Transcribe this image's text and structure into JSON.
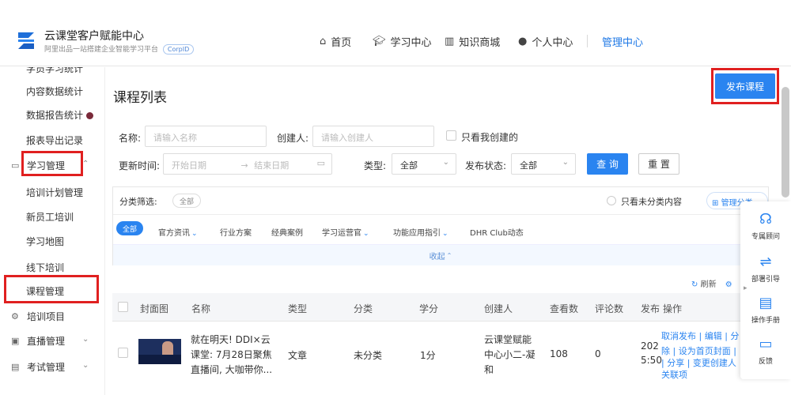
{
  "brand": {
    "title": "云课堂客户赋能中心",
    "subtitle": "阿里出品一站搭建企业智能学习平台",
    "corp_tag": "CorpID"
  },
  "nav": {
    "home": "首页",
    "learning": "学习中心",
    "mall": "知识商城",
    "personal": "个人中心",
    "admin": "管理中心"
  },
  "sidebar": {
    "partial_top": "学员学习统计",
    "items": [
      "内容数据统计",
      "数据报告统计",
      "报表导出记录"
    ],
    "group_learning": "学习管理",
    "sub_items": [
      "培训计划管理",
      "新员工培训",
      "学习地图",
      "线下培训",
      "课程管理"
    ],
    "group_training": "培训项目",
    "group_live": "直播管理",
    "group_exam": "考试管理"
  },
  "page": {
    "title": "课程列表",
    "publish_button": "发布课程"
  },
  "filters": {
    "name_label": "名称:",
    "name_placeholder": "请输入名称",
    "creator_label": "创建人:",
    "creator_placeholder": "请输入创建人",
    "mine_only": "只看我创建的",
    "update_time_label": "更新时间:",
    "start_date": "开始日期",
    "date_sep": "→",
    "end_date": "结束日期",
    "type_label": "类型:",
    "type_value": "全部",
    "status_label": "发布状态:",
    "status_value": "全部",
    "query_button": "查 询",
    "reset_button": "重 置"
  },
  "categories": {
    "filter_label": "分类筛选:",
    "all_tag": "全部",
    "uncategorized": "只看未分类内容",
    "manage": "管理分类",
    "tabs": [
      {
        "label": "全部",
        "active": true
      },
      {
        "label": "官方资讯",
        "chevron": true
      },
      {
        "label": "行业方案"
      },
      {
        "label": "经典案例"
      },
      {
        "label": "学习运营官",
        "chevron": true
      },
      {
        "label": "功能应用指引",
        "chevron": true
      },
      {
        "label": "DHR Club动态"
      }
    ],
    "collapse": "收起"
  },
  "table": {
    "refresh": "刷新",
    "columns": [
      "封面图",
      "名称",
      "类型",
      "分类",
      "学分",
      "创建人",
      "查看数",
      "评论数",
      "发布",
      "操作"
    ],
    "rows": [
      {
        "name_line1": "就在明天! DDI×云",
        "name_line2": "课堂: 7月28日聚焦",
        "name_line3": "直播间, 大咖带你...",
        "type": "文章",
        "category": "未分类",
        "credits": "1分",
        "creator_line1": "云课堂赋能",
        "creator_line2": "中心小二-凝",
        "creator_line3": "和",
        "views": "108",
        "comments": "0",
        "publish_line1": "202",
        "publish_line2": "5:50",
        "ops_line1": "取消发布 | 编辑 | 分",
        "ops_line2": "除 | 设为首页封面 |",
        "ops_line3": "| 分享 | 变更创建人",
        "ops_line4": "关联项"
      }
    ]
  },
  "float_panel": {
    "advisor": "专属顾问",
    "guide": "部署引导",
    "manual": "操作手册",
    "feedback": "反馈"
  },
  "colors": {
    "accent": "#2a84f0",
    "highlight": "#e02020"
  }
}
